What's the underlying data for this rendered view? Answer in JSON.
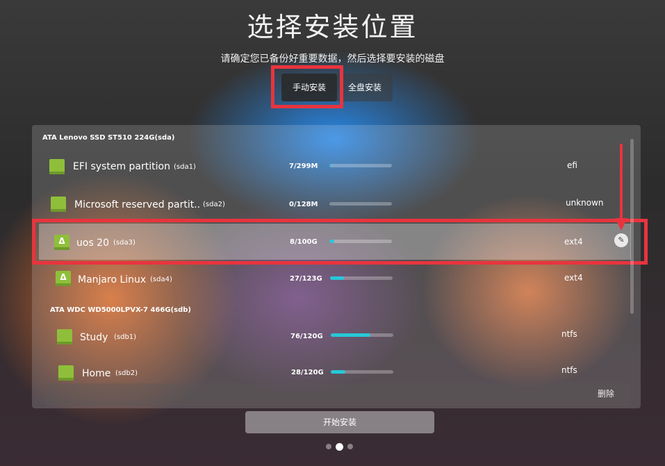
{
  "title": "选择安装位置",
  "subtitle": "请确定您已备份好重要数据，然后选择要安装的磁盘",
  "mode_tabs": {
    "manual": "手动安装",
    "full": "全盘安装"
  },
  "disks": [
    {
      "header": "ATA Lenovo SSD ST510 224G(sda)"
    },
    {
      "header": "ATA WDC WD5000LPVX-7 466G(sdb)"
    }
  ],
  "partitions": [
    {
      "name": "EFI system partition",
      "dev": "(sda1)",
      "size": "7/299M",
      "usage": 0.02,
      "fs": "efi"
    },
    {
      "name": "Microsoft reserved partit..",
      "dev": "(sda2)",
      "size": "0/128M",
      "usage": 0.0,
      "fs": "unknown"
    },
    {
      "name": "uos 20",
      "dev": "(sda3)",
      "size": "8/100G",
      "usage": 0.08,
      "fs": "ext4",
      "selected": true
    },
    {
      "name": "Manjaro Linux",
      "dev": "(sda4)",
      "size": "27/123G",
      "usage": 0.22,
      "fs": "ext4"
    },
    {
      "name": "Study",
      "dev": "(sdb1)",
      "size": "76/120G",
      "usage": 0.63,
      "fs": "ntfs"
    },
    {
      "name": "Home",
      "dev": "(sdb2)",
      "size": "28/120G",
      "usage": 0.23,
      "fs": "ntfs"
    }
  ],
  "delete_label": "删除",
  "start_label": "开始安装",
  "highlight_color": "#e8343e",
  "usage_bar_color": "#27c8d8",
  "partition_icon_color": "#8fbf3a",
  "page_indicator": {
    "count": 3,
    "active": 2
  }
}
